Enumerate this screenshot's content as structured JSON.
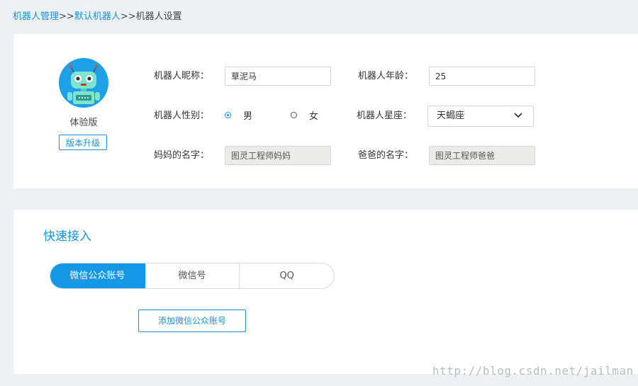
{
  "breadcrumb": {
    "item1": "机器人管理",
    "sep1": ">>",
    "item2": "默认机器人",
    "sep2": ">>",
    "current": "机器人设置"
  },
  "profile": {
    "edition": "体验版",
    "upgrade_label": "版本升级",
    "avatar_icon": "robot-avatar-icon"
  },
  "form": {
    "nickname_label": "机器人昵称：",
    "nickname_value": "草泥马",
    "age_label": "机器人年龄：",
    "age_value": "25",
    "gender_label": "机器人性别：",
    "gender_options": [
      "男",
      "女"
    ],
    "gender_selected": "男",
    "zodiac_label": "机器人星座：",
    "zodiac_value": "天蝎座",
    "mother_label": "妈妈的名字：",
    "mother_value": "图灵工程师妈妈",
    "father_label": "爸爸的名字：",
    "father_value": "图灵工程师爸爸"
  },
  "quick_access": {
    "title": "快速接入",
    "tabs": [
      "微信公众账号",
      "微信号",
      "QQ"
    ],
    "active_tab": "微信公众账号",
    "add_button": "添加微信公众账号"
  },
  "watermark": "http://blog.csdn.net/jailman",
  "colors": {
    "accent": "#1a8fdb",
    "tab_active": "#1497e4",
    "background": "#eef1f4",
    "disabled_input": "#ebebe8"
  }
}
